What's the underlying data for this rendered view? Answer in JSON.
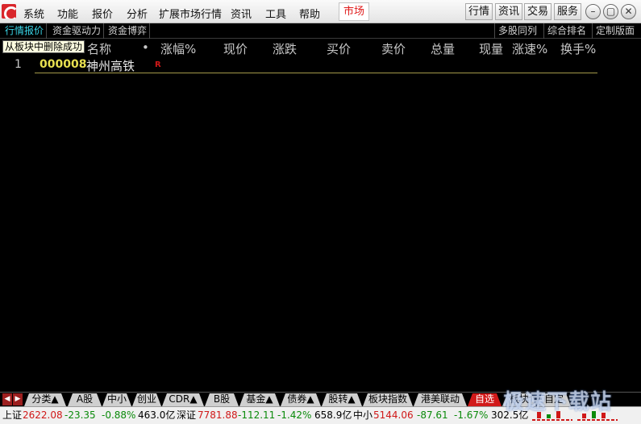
{
  "menu": [
    "系统",
    "功能",
    "报价",
    "分析",
    "扩展市场行情",
    "资讯",
    "工具",
    "帮助"
  ],
  "active_menu": "市场",
  "top_buttons": [
    "行情",
    "资讯",
    "交易",
    "服务"
  ],
  "window_controls": [
    "minimize-icon",
    "restore-icon",
    "close-icon"
  ],
  "subtabs": [
    "行情报价",
    "资金驱动力",
    "资金博弈"
  ],
  "subtabs_right": [
    "多股同列",
    "综合排名",
    "定制版面"
  ],
  "notice": "从板块中删除成功",
  "table": {
    "headers": [
      "名称",
      "•",
      "涨幅%",
      "现价",
      "涨跌",
      "买价",
      "卖价",
      "总量",
      "现量",
      "涨速%",
      "换手%"
    ],
    "rows": [
      {
        "index": "1",
        "code": "000008",
        "name": "神州高铁",
        "flag": "R"
      }
    ]
  },
  "bottom_tabs": [
    "分类▲",
    "A股",
    "中小",
    "创业",
    "CDR▲",
    "B股",
    "基金▲",
    "债券▲",
    "股转▲",
    "板块指数",
    "港美联动",
    "自选",
    "板块",
    "自定"
  ],
  "active_bottom_tab": "自选",
  "status": {
    "sh_label": "上证",
    "sh_value": "2622.08",
    "sh_change": "-23.35",
    "sh_pct": "-0.88%",
    "sh_amount": "463.0亿",
    "sz_label": "深证",
    "sz_value": "7781.88",
    "sz_change": "-112.11",
    "sz_pct": "-1.42%",
    "sz_amount": "658.9亿",
    "zx_label": "中小",
    "zx_value": "5144.06",
    "zx_change": "-87.61",
    "zx_pct": "-1.67%",
    "zx_amount": "302.5亿"
  },
  "watermark": "极速下载站",
  "colors": {
    "up": "#d01818",
    "down": "#0a8a0a",
    "code": "#e8e050",
    "active_tab": "#d11a1a",
    "highlight": "#3ad6e8"
  }
}
